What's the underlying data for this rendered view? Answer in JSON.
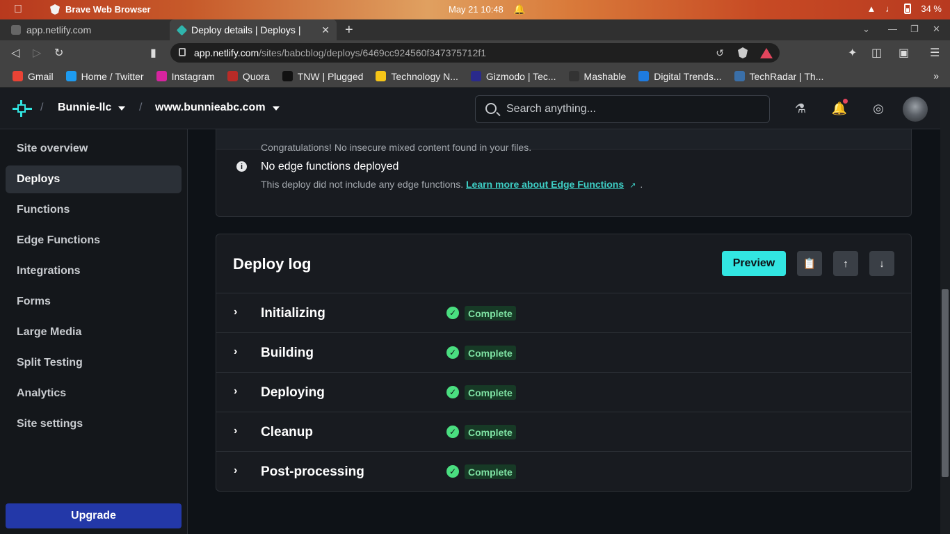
{
  "os": {
    "app_name": "Brave Web Browser",
    "date_time": "May 21  10:48",
    "battery": "34 %"
  },
  "browser": {
    "tabs": [
      {
        "title": "app.netlify.com"
      },
      {
        "title": "Deploy details | Deploys | "
      }
    ],
    "url_host": "app.netlify.com",
    "url_path": "/sites/babcblog/deploys/6469cc924560f347375712f1",
    "bookmarks": [
      {
        "label": "Gmail",
        "color": "#ea4335"
      },
      {
        "label": "Home / Twitter",
        "color": "#1d9bf0"
      },
      {
        "label": "Instagram",
        "color": "#d6249f"
      },
      {
        "label": "Quora",
        "color": "#b92b27"
      },
      {
        "label": "TNW | Plugged",
        "color": "#111111"
      },
      {
        "label": "Technology N...",
        "color": "#f5c518"
      },
      {
        "label": "Gizmodo | Tec...",
        "color": "#2a2a8c"
      },
      {
        "label": "Mashable",
        "color": "#333333"
      },
      {
        "label": "Digital Trends...",
        "color": "#1e7be0"
      },
      {
        "label": "TechRadar | Th...",
        "color": "#3a6fa8"
      }
    ],
    "bookmarks_more": "»"
  },
  "header": {
    "team": "Bunnie-llc",
    "site": "www.bunnieabc.com",
    "search_placeholder": "Search anything..."
  },
  "sidebar": {
    "items": [
      {
        "label": "Site overview",
        "active": false
      },
      {
        "label": "Deploys",
        "active": true
      },
      {
        "label": "Functions",
        "active": false
      },
      {
        "label": "Edge Functions",
        "active": false
      },
      {
        "label": "Integrations",
        "active": false
      },
      {
        "label": "Forms",
        "active": false
      },
      {
        "label": "Large Media",
        "active": false
      },
      {
        "label": "Split Testing",
        "active": false
      },
      {
        "label": "Analytics",
        "active": false
      },
      {
        "label": "Site settings",
        "active": false
      }
    ],
    "upgrade_label": "Upgrade"
  },
  "checks": {
    "mixed_content_text": "Congratulations! No insecure mixed content found in your files.",
    "edge_title": "No edge functions deployed",
    "edge_desc": "This deploy did not include any edge functions.",
    "edge_link": "Learn more about Edge Functions",
    "edge_link_suffix": "."
  },
  "deploy_log": {
    "title": "Deploy log",
    "preview_label": "Preview",
    "steps": [
      {
        "name": "Initializing",
        "status": "Complete"
      },
      {
        "name": "Building",
        "status": "Complete"
      },
      {
        "name": "Deploying",
        "status": "Complete"
      },
      {
        "name": "Cleanup",
        "status": "Complete"
      },
      {
        "name": "Post-processing",
        "status": "Complete"
      }
    ]
  },
  "colors": {
    "accent": "#32e6e2",
    "link": "#3ecfc6",
    "success": "#4ade80",
    "upgrade": "#2338a8"
  }
}
